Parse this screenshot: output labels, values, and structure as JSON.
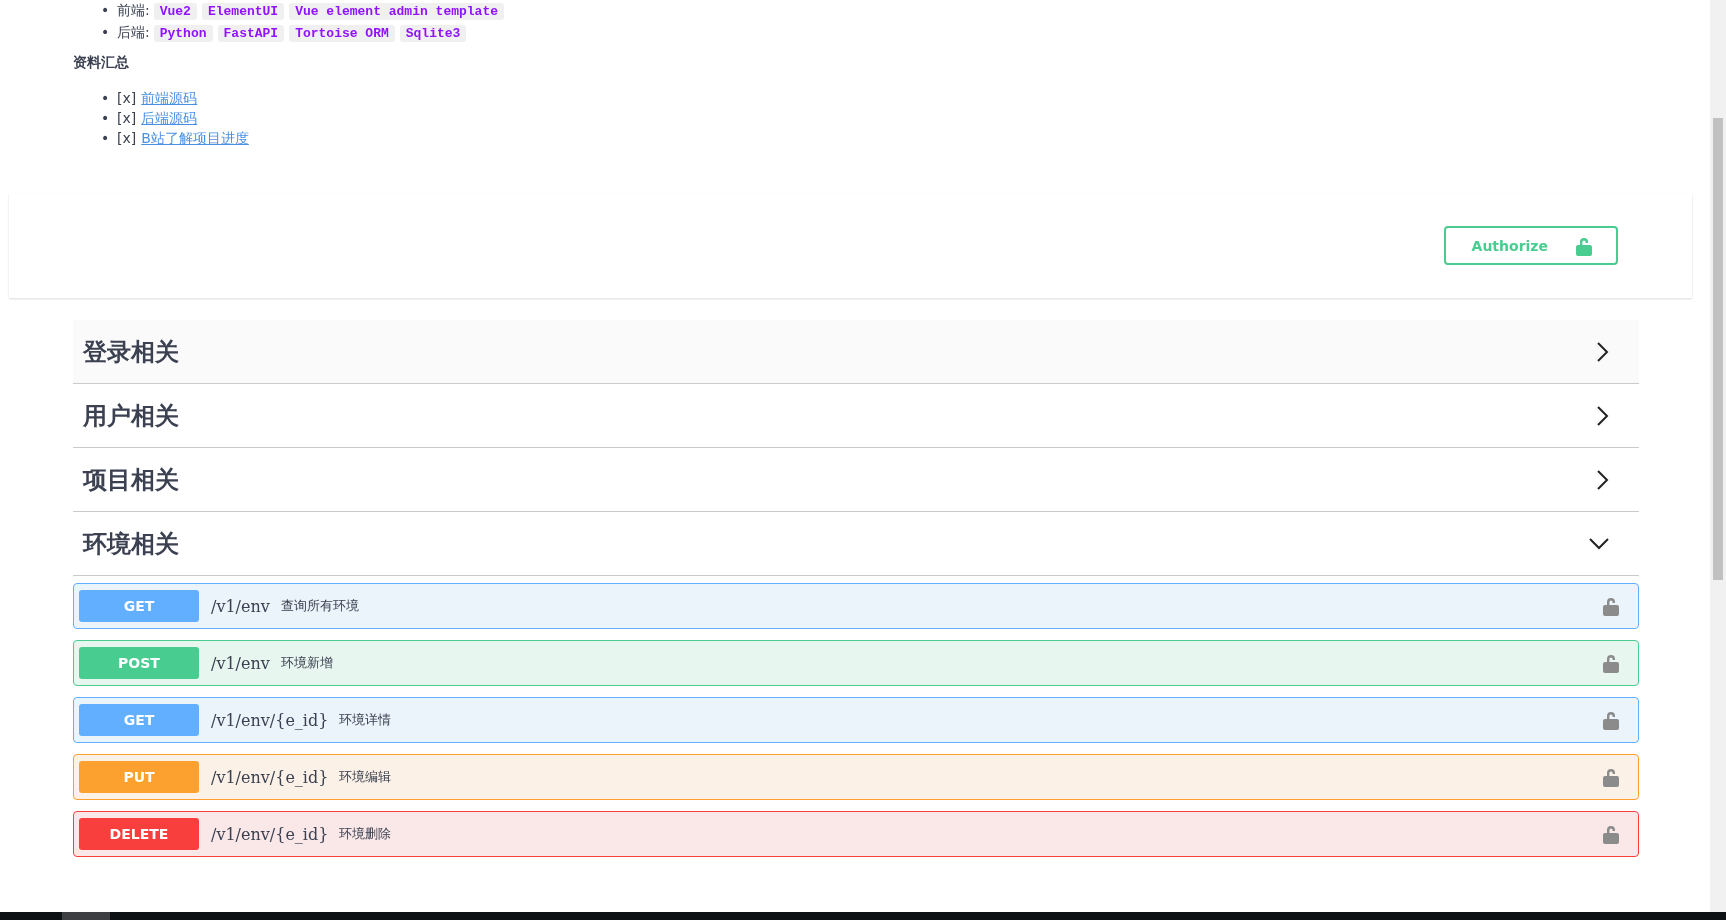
{
  "intro": {
    "bullet": "•",
    "stack": [
      {
        "label": "前端:",
        "tags": [
          "Vue2",
          "ElementUI",
          "Vue element admin template"
        ]
      },
      {
        "label": "后端:",
        "tags": [
          "Python",
          "FastAPI",
          "Tortoise ORM",
          "Sqlite3"
        ]
      }
    ],
    "heading": "资料汇总",
    "links": [
      {
        "mark": "[x]",
        "text": "前端源码"
      },
      {
        "mark": "[x]",
        "text": "后端源码"
      },
      {
        "mark": "[x]",
        "text": "B站了解项目进度"
      }
    ]
  },
  "authorize": {
    "label": "Authorize"
  },
  "sections": [
    {
      "title": "登录相关",
      "expanded": false
    },
    {
      "title": "用户相关",
      "expanded": false
    },
    {
      "title": "项目相关",
      "expanded": false
    },
    {
      "title": "环境相关",
      "expanded": true,
      "operations": [
        {
          "method": "GET",
          "path": "/v1/env",
          "summary": "查询所有环境"
        },
        {
          "method": "POST",
          "path": "/v1/env",
          "summary": "环境新增"
        },
        {
          "method": "GET",
          "path": "/v1/env/{e_id}",
          "summary": "环境详情"
        },
        {
          "method": "PUT",
          "path": "/v1/env/{e_id}",
          "summary": "环境编辑"
        },
        {
          "method": "DELETE",
          "path": "/v1/env/{e_id}",
          "summary": "环境删除"
        }
      ]
    }
  ]
}
